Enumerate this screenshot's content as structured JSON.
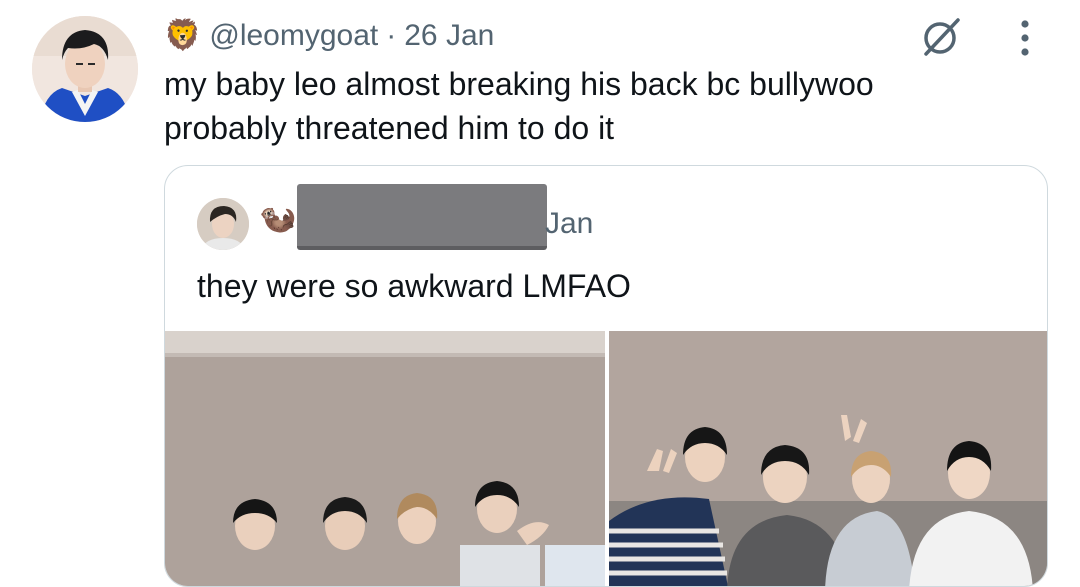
{
  "tweet": {
    "handle": "@leomygoat",
    "separator": "·",
    "date": "26 Jan",
    "name_emoji": "🦁",
    "text": "my baby leo almost breaking his back bc bullywoo probably threatened him to do it"
  },
  "quote": {
    "name_emoji": "🦦",
    "date_partial": "Jan",
    "text": "they were so awkward LMFAO"
  },
  "icons": {
    "grok": "grok-icon",
    "more": "more-vertical-icon"
  },
  "colors": {
    "text_primary": "#0f1419",
    "text_secondary": "#536471",
    "border": "#cfd9de",
    "redaction": "#7b7b7e"
  }
}
